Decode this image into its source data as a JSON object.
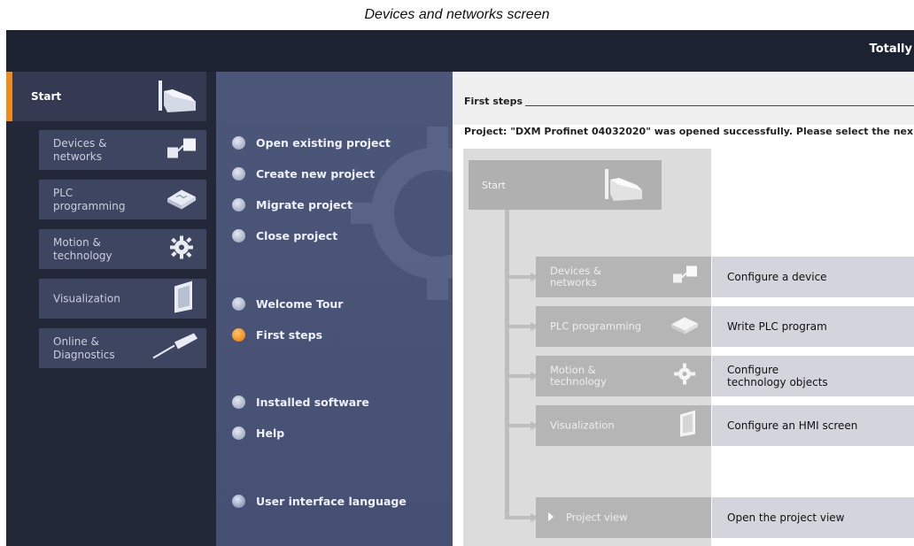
{
  "caption": "Devices and networks screen",
  "header": {
    "brand": "Totally"
  },
  "leftnav": {
    "start": {
      "label": "Start"
    },
    "items": [
      {
        "label": "Devices &\nnetworks",
        "icon": "devices-networks-icon"
      },
      {
        "label": "PLC\nprogramming",
        "icon": "plc-programming-icon"
      },
      {
        "label": "Motion &\ntechnology",
        "icon": "motion-gear-icon"
      },
      {
        "label": "Visualization",
        "icon": "hmi-panel-icon"
      },
      {
        "label": "Online &\nDiagnostics",
        "icon": "screwdriver-icon"
      }
    ]
  },
  "middle": {
    "items": [
      {
        "label": "Open existing project",
        "state": "normal"
      },
      {
        "label": "Create new project",
        "state": "normal"
      },
      {
        "label": "Migrate project",
        "state": "normal"
      },
      {
        "label": "Close project",
        "state": "normal"
      },
      {
        "label": "Welcome Tour",
        "state": "normal"
      },
      {
        "label": "First steps",
        "state": "active"
      },
      {
        "label": "Installed software",
        "state": "normal"
      },
      {
        "label": "Help",
        "state": "normal"
      },
      {
        "label": "User interface language",
        "state": "globe"
      }
    ]
  },
  "content": {
    "title": "First steps",
    "message": "Project: \"DXM Profinet 04032020\" was opened successfully. Please select the nex",
    "flow_start": "Start",
    "steps": [
      {
        "label": "Devices &\nnetworks",
        "desc": "Configure a device",
        "icon": "devices-networks-icon"
      },
      {
        "label": "PLC programming",
        "desc": "Write PLC program",
        "icon": "plc-programming-icon"
      },
      {
        "label": "Motion &\ntechnology",
        "desc": "Configure\ntechnology objects",
        "icon": "motion-gear-icon"
      },
      {
        "label": "Visualization",
        "desc": "Configure an HMI screen",
        "icon": "hmi-panel-icon"
      },
      {
        "label": "Project view",
        "desc": "Open the project view",
        "icon": "play-triangle-icon"
      }
    ]
  },
  "colors": {
    "accent": "#f08b1d",
    "topbar": "#1d2232",
    "nav": "#232839",
    "panel": "#4c5678"
  }
}
